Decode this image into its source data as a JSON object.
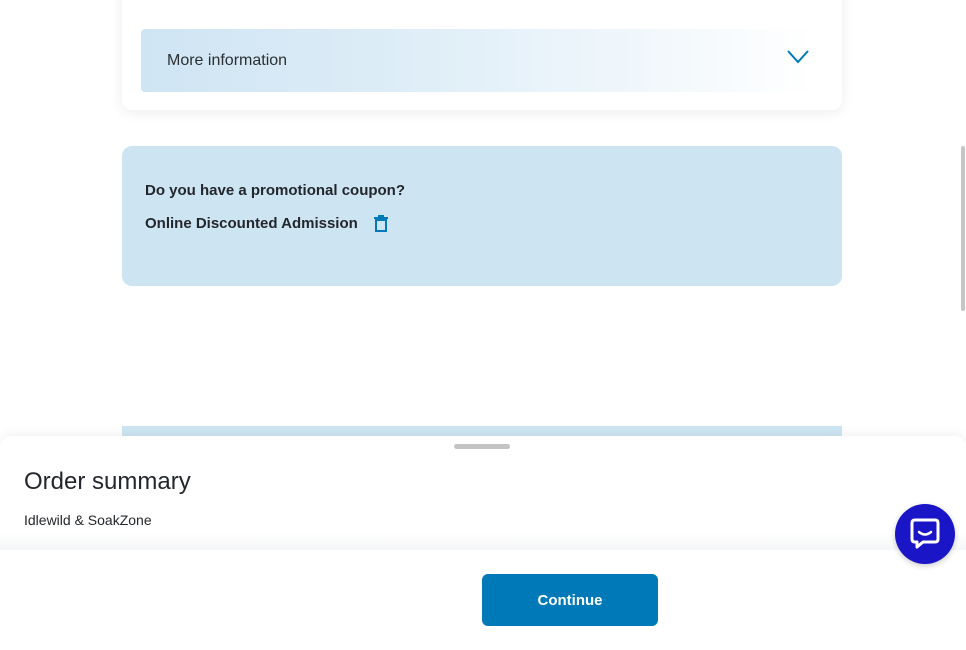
{
  "more_info": {
    "label": "More information",
    "icon": "chevron-down-icon"
  },
  "promo": {
    "question": "Do you have a promotional coupon?",
    "coupon_name": "Online Discounted Admission",
    "remove_icon": "trash-icon"
  },
  "order_summary": {
    "title": "Order summary",
    "park": "Idlewild & SoakZone"
  },
  "footer": {
    "continue_label": "Continue"
  },
  "chat": {
    "icon": "chat-bubble-icon"
  },
  "colors": {
    "accent": "#0079b8",
    "promo_bg": "#cde5f2",
    "chat_bg": "#1a16c8"
  }
}
